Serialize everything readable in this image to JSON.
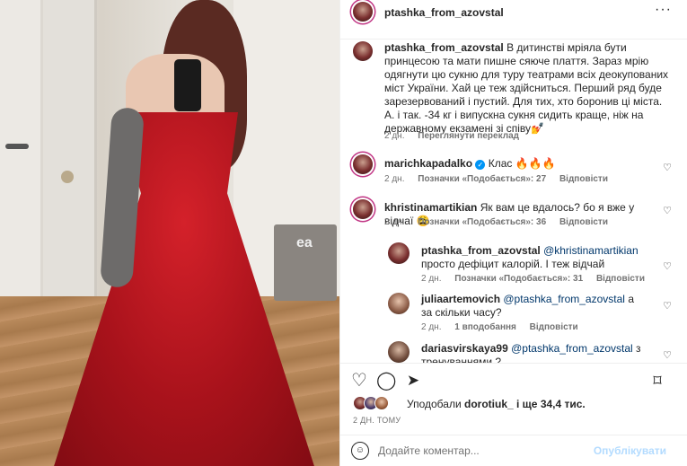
{
  "post": {
    "username": "ptashka_from_azovstal",
    "more_icon": "more-horizontal-icon"
  },
  "caption": {
    "username": "ptashka_from_azovstal",
    "text": "В дитинстві мріяла бути принцесою та мати пишне сяюче плаття. Зараз мрію одягнути цю сукню для туру театрами всіх деокупованих міст України. Хай це теж здійсниться. Перший ряд буде зарезервований і пустий. Для тих, хто боронив ці міста.",
    "text2": "А. і так. -34 кг і випускна сукня сидить краще, ніж на державному екзамені зі співу💅",
    "time": "2 дн.",
    "translate": "Переглянути переклад"
  },
  "comments": [
    {
      "username": "marichkapadalko",
      "verified": true,
      "text": "Клас 🔥🔥🔥",
      "time": "2 дн.",
      "likes": "Позначки «Подобається»: 27",
      "reply": "Відповісти"
    },
    {
      "username": "khristinamartikian",
      "text": "Як вам це вдалось? бо я вже у відчаї 😩",
      "time": "2 дн.",
      "likes": "Позначки «Подобається»: 36",
      "reply": "Відповісти"
    },
    {
      "username": "ptashka_from_azovstal",
      "mention": "@khristinamartikian",
      "text": "просто дефіцит калорій. І теж відчай",
      "time": "2 дн.",
      "likes": "Позначки «Подобається»: 31",
      "reply": "Відповісти"
    },
    {
      "username": "juliaartemovich",
      "mention": "@ptashka_from_azovstal",
      "text": "а за скільки часу?",
      "time": "2 дн.",
      "likes": "1 вподобання",
      "reply": "Відповісти"
    },
    {
      "username": "dariasvirskaya99",
      "mention": "@ptashka_from_azovstal",
      "text": "з тренуваннями ?"
    }
  ],
  "likes_line": {
    "prefix": "Уподобали",
    "user": "dorotiuk_",
    "suffix": "і ще 34,4 тис."
  },
  "posted_ago": "2 ДН. ТОМУ",
  "composer": {
    "placeholder": "Додайте коментар...",
    "publish": "Опублікувати"
  },
  "photo_text": {
    "bag_logo": "ea"
  },
  "colors": {
    "link": "#00376b",
    "meta": "#737373",
    "publish_disabled": "#b3dbff",
    "verified": "#0095f6"
  }
}
